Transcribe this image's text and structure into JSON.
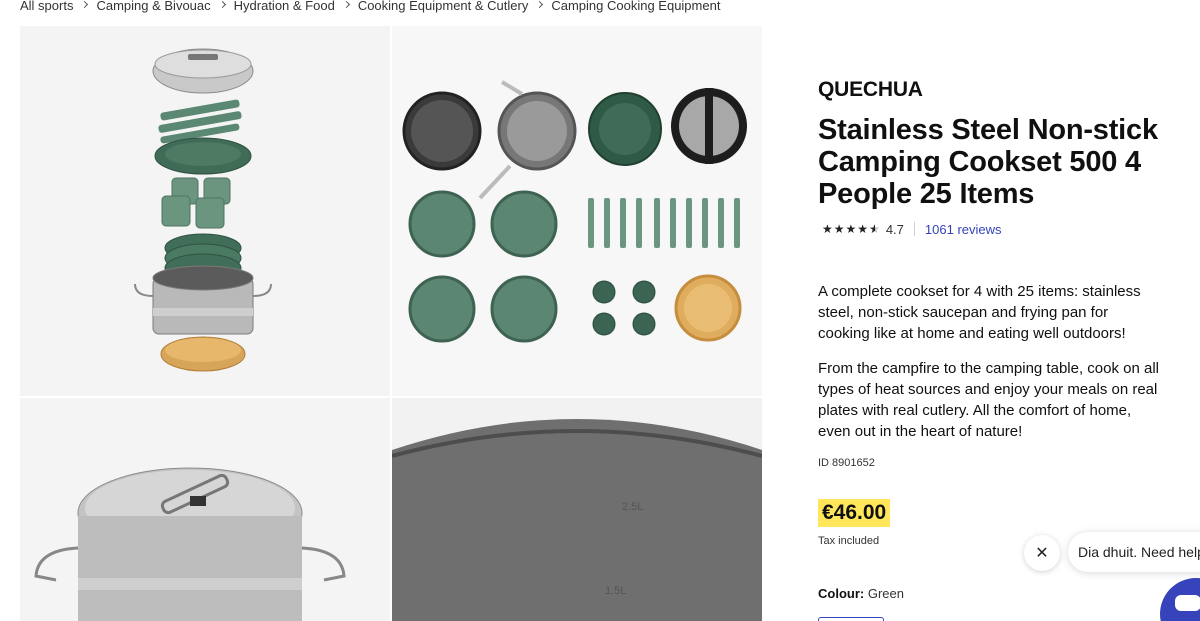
{
  "breadcrumb": [
    "All sports",
    "Camping & Bivouac",
    "Hydration & Food",
    "Cooking Equipment & Cutlery",
    "Camping Cooking Equipment"
  ],
  "gallery": {
    "pot_capacity_marks": [
      "2.5L",
      "1.5L"
    ]
  },
  "product": {
    "brand": "QUECHUA",
    "title": "Stainless Steel Non-stick Camping Cookset 500 4 People 25 Items",
    "rating": "4.7",
    "stars": 4.5,
    "reviews": "1061 reviews",
    "description_1": "A complete cookset for 4 with 25 items: stainless steel, non-stick saucepan and frying pan for cooking like at home and eating well outdoors!",
    "description_2": "From the campfire to the camping table, cook on all types of heat sources and enjoy your meals on real plates with real cutlery. All the comfort of home, even out in the heart of nature!",
    "id_label": "ID 8901652",
    "price": "€46.00",
    "tax_note": "Tax included",
    "colour_label": "Colour:",
    "colour_value": "Green"
  },
  "chat": {
    "message": "Dia dhuit. Need help",
    "close_icon": "close-icon"
  },
  "colors": {
    "accent": "#3643ba",
    "price_highlight": "#ffe65a",
    "product_green": "#4e7a64"
  }
}
